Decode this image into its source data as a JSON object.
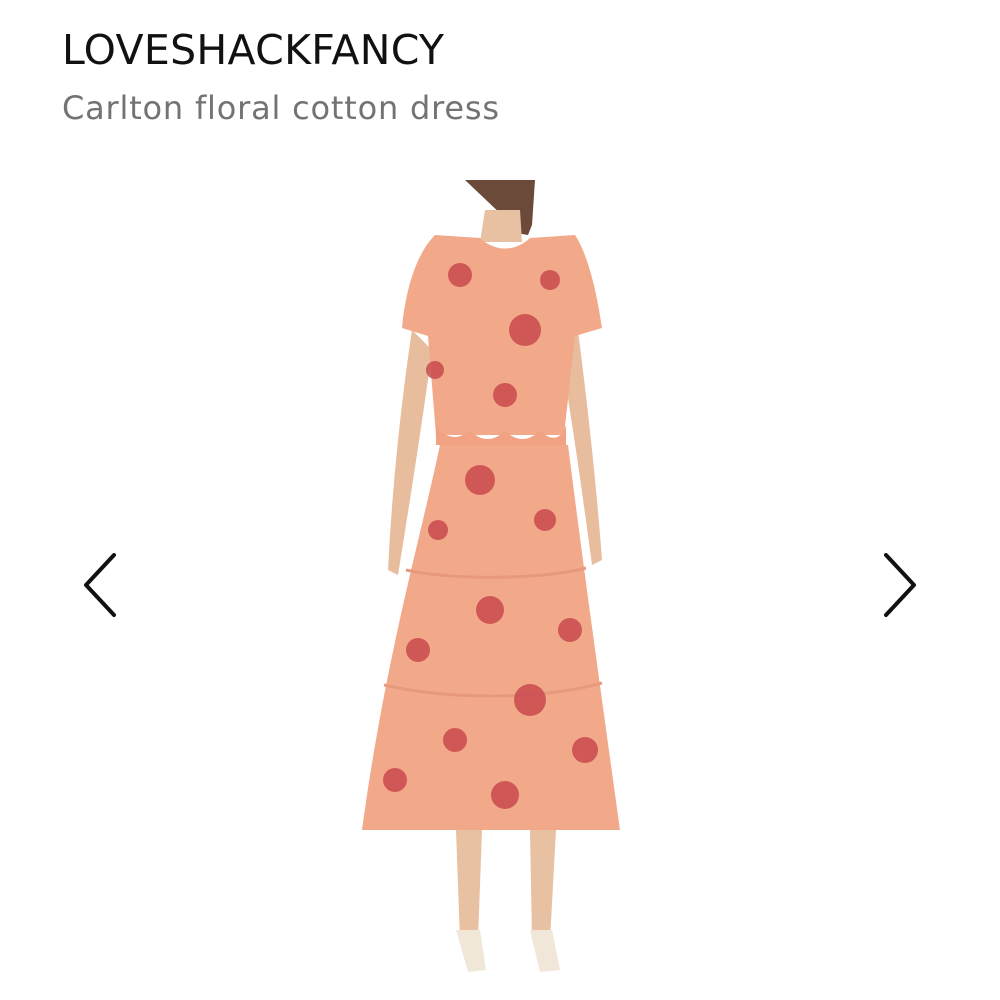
{
  "product": {
    "brand": "LOVESHACKFANCY",
    "name": "Carlton floral cotton dress"
  },
  "gallery": {
    "prev_icon": "chevron-left-icon",
    "next_icon": "chevron-right-icon"
  },
  "colors": {
    "dress": "#f2a98a",
    "floral": "#c94a4f",
    "arrow": "#111111"
  }
}
